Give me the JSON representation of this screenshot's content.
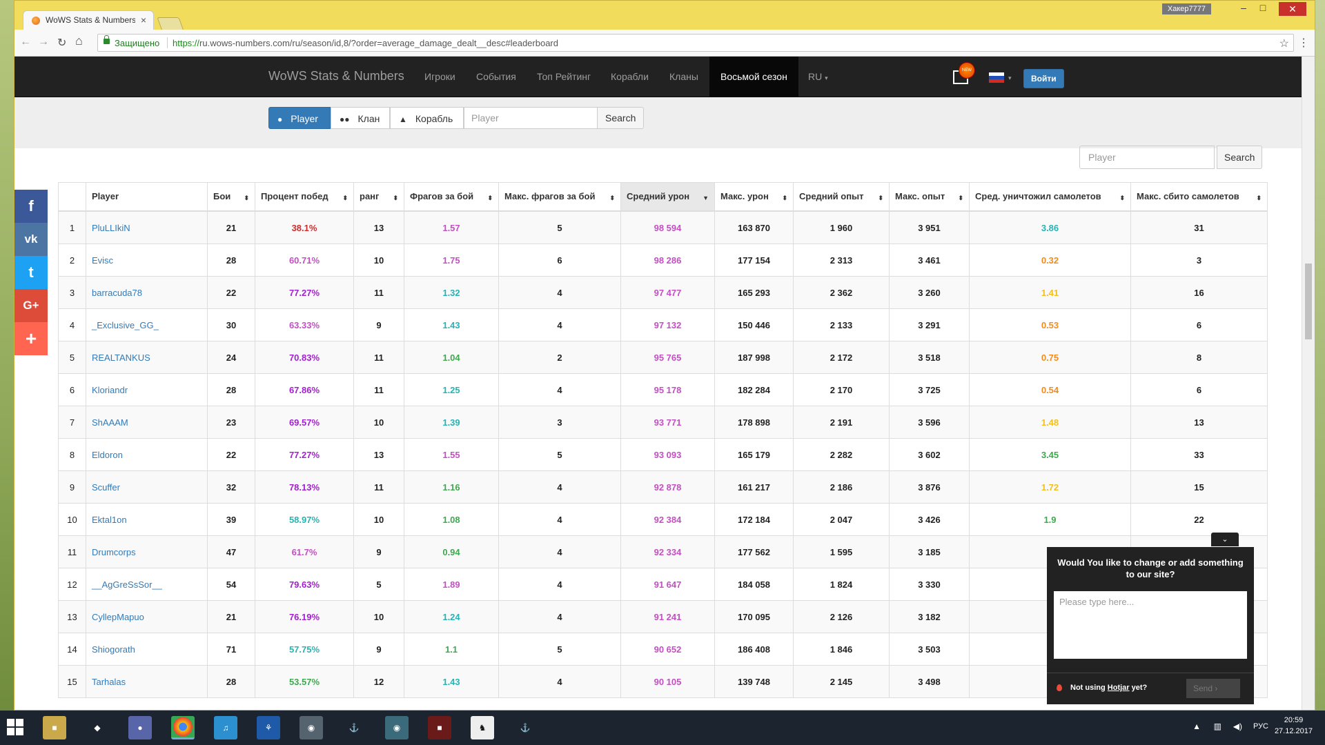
{
  "browser": {
    "tab_title": "WoWS Stats & Numbers",
    "tab_close": "×",
    "user_badge": "Хакер7777",
    "secure_label": "Защищено",
    "url_scheme": "https://",
    "url_rest": "ru.wows-numbers.com/ru/season/id,8/?order=average_damage_dealt__desc#leaderboard",
    "nav_back": "←",
    "nav_forward": "→",
    "nav_reload": "↻",
    "nav_home": "⌂",
    "star": "☆",
    "menu": "⋮",
    "win_min": "–",
    "win_max": "□",
    "win_close": "✕"
  },
  "site_nav": {
    "brand": "WoWS Stats & Numbers",
    "items": [
      "Игроки",
      "События",
      "Топ Рейтинг",
      "Корабли",
      "Кланы"
    ],
    "active_item": "Восьмой сезон",
    "lang": "RU",
    "lang_caret": "▾",
    "flag_caret": "▾",
    "notification_badge": "NEW",
    "login": "Войти"
  },
  "search": {
    "tab_player": "Player",
    "tab_clan": "Клан",
    "tab_ship": "Корабль",
    "placeholder": "Player",
    "button": "Search"
  },
  "table_search": {
    "placeholder": "Player",
    "button": "Search"
  },
  "social": {
    "facebook": "f",
    "vk": "vk",
    "twitter": "t",
    "gplus": "G+",
    "more": "+"
  },
  "table": {
    "columns": [
      "",
      "Player",
      "Бои",
      "Процент побед",
      "ранг",
      "Фрагов за бой",
      "Макс. фрагов за бой",
      "Средний урон",
      "Макс. урон",
      "Средний опыт",
      "Макс. опыт",
      "Сред. уничтожил самолетов",
      "Макс. сбито самолетов"
    ],
    "sort_arrow": "⬍",
    "sorted_arrow": "▼",
    "rows": [
      [
        "1",
        "PluLLIkiN",
        "21",
        "38.1%",
        "13",
        "1.57",
        "5",
        "98 594",
        "163 870",
        "1 960",
        "3 951",
        "3.86",
        "31"
      ],
      [
        "2",
        "Evisc",
        "28",
        "60.71%",
        "10",
        "1.75",
        "6",
        "98 286",
        "177 154",
        "2 313",
        "3 461",
        "0.32",
        "3"
      ],
      [
        "3",
        "barracuda78",
        "22",
        "77.27%",
        "11",
        "1.32",
        "4",
        "97 477",
        "165 293",
        "2 362",
        "3 260",
        "1.41",
        "16"
      ],
      [
        "4",
        "_Exclusive_GG_",
        "30",
        "63.33%",
        "9",
        "1.43",
        "4",
        "97 132",
        "150 446",
        "2 133",
        "3 291",
        "0.53",
        "6"
      ],
      [
        "5",
        "REALTANKUS",
        "24",
        "70.83%",
        "11",
        "1.04",
        "2",
        "95 765",
        "187 998",
        "2 172",
        "3 518",
        "0.75",
        "8"
      ],
      [
        "6",
        "Kloriandr",
        "28",
        "67.86%",
        "11",
        "1.25",
        "4",
        "95 178",
        "182 284",
        "2 170",
        "3 725",
        "0.54",
        "6"
      ],
      [
        "7",
        "ShAAAM",
        "23",
        "69.57%",
        "10",
        "1.39",
        "3",
        "93 771",
        "178 898",
        "2 191",
        "3 596",
        "1.48",
        "13"
      ],
      [
        "8",
        "Eldoron",
        "22",
        "77.27%",
        "13",
        "1.55",
        "5",
        "93 093",
        "165 179",
        "2 282",
        "3 602",
        "3.45",
        "33"
      ],
      [
        "9",
        "Scuffer",
        "32",
        "78.13%",
        "11",
        "1.16",
        "4",
        "92 878",
        "161 217",
        "2 186",
        "3 876",
        "1.72",
        "15"
      ],
      [
        "10",
        "Ektal1on",
        "39",
        "58.97%",
        "10",
        "1.08",
        "4",
        "92 384",
        "172 184",
        "2 047",
        "3 426",
        "1.9",
        "22"
      ],
      [
        "11",
        "Drumcorps",
        "47",
        "61.7%",
        "9",
        "0.94",
        "4",
        "92 334",
        "177 562",
        "1 595",
        "3 185",
        "",
        ""
      ],
      [
        "12",
        "__AgGreSsSor__",
        "54",
        "79.63%",
        "5",
        "1.89",
        "4",
        "91 647",
        "184 058",
        "1 824",
        "3 330",
        "",
        ""
      ],
      [
        "13",
        "CyllepMapuo",
        "21",
        "76.19%",
        "10",
        "1.24",
        "4",
        "91 241",
        "170 095",
        "2 126",
        "3 182",
        "",
        ""
      ],
      [
        "14",
        "Shiogorath",
        "71",
        "57.75%",
        "9",
        "1.1",
        "5",
        "90 652",
        "186 408",
        "1 846",
        "3 503",
        "",
        ""
      ],
      [
        "15",
        "Tarhalas",
        "28",
        "53.57%",
        "12",
        "1.43",
        "4",
        "90 105",
        "139 748",
        "2 145",
        "3 498",
        "",
        ""
      ]
    ],
    "colors": {
      "winrate": [
        "#d42a2a",
        "#c34fc3",
        "#a41ed1",
        "#c34fc3",
        "#a41ed1",
        "#a41ed1",
        "#a41ed1",
        "#a41ed1",
        "#a41ed1",
        "#26b3b3",
        "#c34fc3",
        "#a41ed1",
        "#a41ed1",
        "#26b3b3",
        "#3fa84f"
      ],
      "frags": [
        "#c34fc3",
        "#c34fc3",
        "#26b3b3",
        "#26b3b3",
        "#3fa84f",
        "#26b3b3",
        "#26b3b3",
        "#c34fc3",
        "#3fa84f",
        "#3fa84f",
        "#3fa84f",
        "#c34fc3",
        "#26b3b3",
        "#3fa84f",
        "#26b3b3"
      ],
      "damage": "#c34fc3",
      "planes": [
        "#26b3b3",
        "#f08c1e",
        "#f0c020",
        "#f08c1e",
        "#f08c1e",
        "#f08c1e",
        "#f0c020",
        "#3fa84f",
        "#f0c020",
        "#3fa84f",
        "",
        "",
        "",
        "",
        ""
      ]
    }
  },
  "hotjar": {
    "toggle": "⌄",
    "title": "Would You like to change or add something to our site?",
    "placeholder": "Please type here...",
    "note_prefix": "Not using ",
    "note_link": "Hotjar",
    "note_suffix": " yet?",
    "send": "Send  ›"
  },
  "taskbar": {
    "lang": "РУС",
    "time": "20:59",
    "date": "27.12.2017",
    "tray_up": "▲",
    "tray_net": "▥",
    "tray_vol": "◀)"
  }
}
